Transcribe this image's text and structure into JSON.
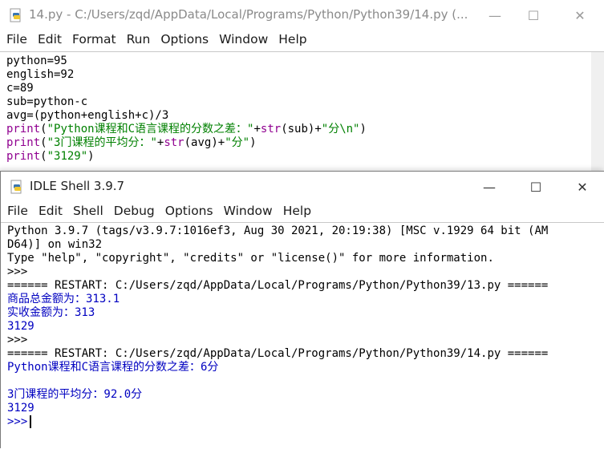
{
  "editor": {
    "title": "14.py - C:/Users/zqd/AppData/Local/Programs/Python/Python39/14.py (...",
    "menu": [
      "File",
      "Edit",
      "Format",
      "Run",
      "Options",
      "Window",
      "Help"
    ],
    "code": [
      {
        "plain": "python=95"
      },
      {
        "plain": "english=92"
      },
      {
        "plain": "c=89"
      },
      {
        "plain": "sub=python-c"
      },
      {
        "plain": "avg=(python+english+c)/3"
      },
      {
        "kw": "print",
        "p1": "(",
        "s1": "\"Python课程和C语言课程的分数之差：\"",
        "p2": "+",
        "kw2": "str",
        "p3": "(sub)+",
        "s2": "\"分\\n\"",
        "p4": ")"
      },
      {
        "kw": "print",
        "p1": "(",
        "s1": "\"3门课程的平均分：\"",
        "p2": "+",
        "kw2": "str",
        "p3": "(avg)+",
        "s2": "\"分\"",
        "p4": ")"
      },
      {
        "kw": "print",
        "p1": "(",
        "s1": "\"3129\"",
        "p4": ")"
      }
    ]
  },
  "shell": {
    "title": "IDLE Shell 3.9.7",
    "menu": [
      "File",
      "Edit",
      "Shell",
      "Debug",
      "Options",
      "Window",
      "Help"
    ],
    "lines": [
      {
        "text": "Python 3.9.7 (tags/v3.9.7:1016ef3, Aug 30 2021, 20:19:38) [MSC v.1929 64 bit (AM",
        "kind": "plain"
      },
      {
        "text": "D64)] on win32",
        "kind": "plain"
      },
      {
        "text": "Type \"help\", \"copyright\", \"credits\" or \"license()\" for more information.",
        "kind": "plain"
      },
      {
        "text": ">>>",
        "kind": "prompt"
      },
      {
        "text": "====== RESTART: C:/Users/zqd/AppData/Local/Programs/Python/Python39/13.py ======",
        "kind": "plain"
      },
      {
        "text": "商品总金额为：313.1",
        "kind": "out"
      },
      {
        "text": "实收金额为：313",
        "kind": "out"
      },
      {
        "text": "3129",
        "kind": "out"
      },
      {
        "text": ">>>",
        "kind": "prompt"
      },
      {
        "text": "====== RESTART: C:/Users/zqd/AppData/Local/Programs/Python/Python39/14.py ======",
        "kind": "plain"
      },
      {
        "text": "Python课程和C语言课程的分数之差：6分",
        "kind": "out"
      },
      {
        "text": "",
        "kind": "out"
      },
      {
        "text": "3门课程的平均分：92.0分",
        "kind": "out"
      },
      {
        "text": "3129",
        "kind": "out"
      },
      {
        "text": ">>>",
        "kind": "prompt-active"
      }
    ]
  },
  "controls": {
    "minimize": "—",
    "maximize": "☐",
    "close": "✕"
  },
  "colors": {
    "keyword": "#900090",
    "string": "#008000",
    "output": "#0000c0",
    "prompt": "#8b0000"
  }
}
